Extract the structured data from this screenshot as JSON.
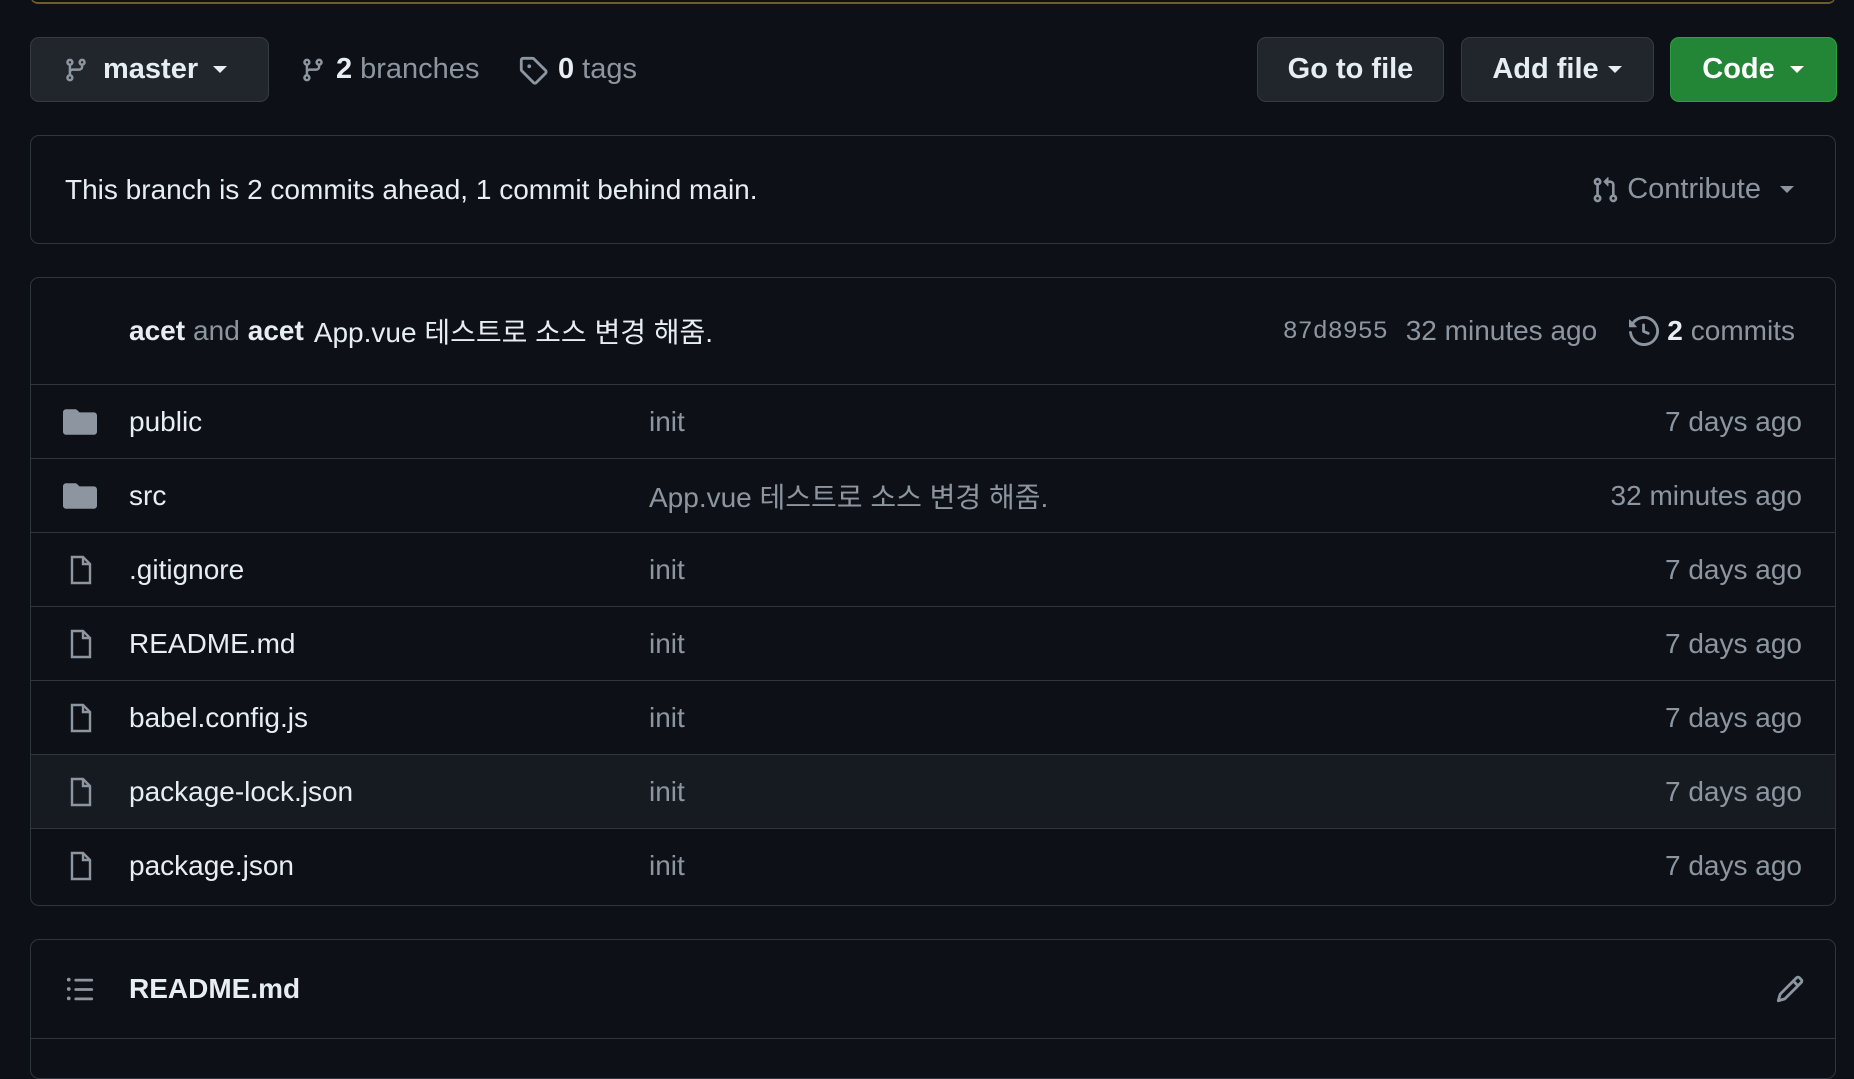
{
  "toolbar": {
    "branch_name": "master",
    "branches_count": "2",
    "branches_label": "branches",
    "tags_count": "0",
    "tags_label": "tags",
    "go_to_file_label": "Go to file",
    "add_file_label": "Add file",
    "code_label": "Code",
    "code_color": "#238636"
  },
  "branch_status": {
    "message": "This branch is 2 commits ahead, 1 commit behind main.",
    "contribute_label": "Contribute"
  },
  "latest_commit": {
    "author1": "acet",
    "and_text": "and",
    "author2": "acet",
    "message": "App.vue 테스트로 소스 변경 해줌.",
    "sha": "87d8955",
    "time": "32 minutes ago",
    "commits_count": "2",
    "commits_label": "commits"
  },
  "files": [
    {
      "type": "folder",
      "icon": "folder-icon",
      "name": "public",
      "message": "init",
      "time": "7 days ago"
    },
    {
      "type": "folder",
      "icon": "folder-icon",
      "name": "src",
      "message": "App.vue 테스트로 소스 변경 해줌.",
      "time": "32 minutes ago"
    },
    {
      "type": "file",
      "icon": "file-icon",
      "name": ".gitignore",
      "message": "init",
      "time": "7 days ago"
    },
    {
      "type": "file",
      "icon": "file-icon",
      "name": "README.md",
      "message": "init",
      "time": "7 days ago"
    },
    {
      "type": "file",
      "icon": "file-icon",
      "name": "babel.config.js",
      "message": "init",
      "time": "7 days ago"
    },
    {
      "type": "file",
      "icon": "file-icon",
      "name": "package-lock.json",
      "message": "init",
      "time": "7 days ago"
    },
    {
      "type": "file",
      "icon": "file-icon",
      "name": "package.json",
      "message": "init",
      "time": "7 days ago"
    }
  ],
  "readme": {
    "title": "README.md"
  }
}
